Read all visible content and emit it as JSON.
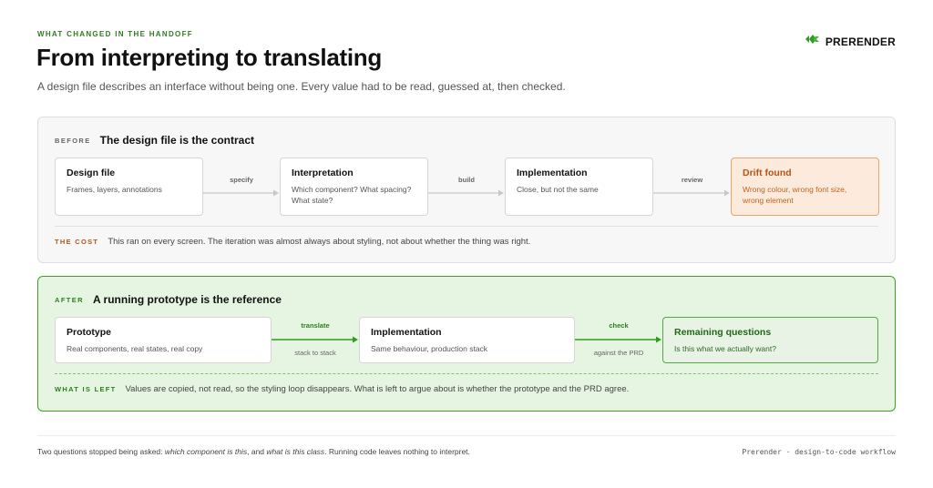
{
  "header": {
    "eyebrow": "WHAT CHANGED IN THE HANDOFF",
    "title": "From interpreting to translating",
    "subtitle": "A design file describes an interface without being one. Every value had to be read, guessed at, then checked."
  },
  "brand": {
    "name": "PRERENDER",
    "icon": "prerender-logo-icon",
    "color": "#2e9c1f"
  },
  "before": {
    "tag": "BEFORE",
    "title": "The design file is the contract",
    "steps": [
      {
        "title": "Design file",
        "desc": "Frames, layers, annotations"
      },
      {
        "title": "Interpretation",
        "desc": "Which component? What spacing? What state?"
      },
      {
        "title": "Implementation",
        "desc": "Close, but not the same"
      },
      {
        "title": "Drift found",
        "desc": "Wrong colour, wrong font size, wrong element"
      }
    ],
    "connectors": [
      "specify",
      "build",
      "review"
    ],
    "note_tag": "THE COST",
    "note": "This ran on every screen. The iteration was almost always about styling, not about whether the thing was right."
  },
  "after": {
    "tag": "AFTER",
    "title": "A running prototype is the reference",
    "steps": [
      {
        "title": "Prototype",
        "desc": "Real components, real states, real copy"
      },
      {
        "title": "Implementation",
        "desc": "Same behaviour, production stack"
      },
      {
        "title": "Remaining questions",
        "desc": "Is this what we actually want?"
      }
    ],
    "connectors": [
      {
        "label": "translate",
        "sub": "stack to stack"
      },
      {
        "label": "check",
        "sub": "against the PRD"
      }
    ],
    "note_tag": "WHAT IS LEFT",
    "note": "Values are copied, not read, so the styling loop disappears. What is left to argue about is whether the prototype and the PRD agree."
  },
  "footer": {
    "left_prefix": "Two questions stopped being asked: ",
    "q1": "which component is this",
    "mid": ", and ",
    "q2": "what is this class",
    "left_suffix": ". Running code leaves nothing to interpret.",
    "right": "Prerender · design-to-code workflow"
  },
  "colors": {
    "accent_green": "#2e7d1f",
    "drift_orange": "#b85412",
    "after_bg": "#e6f5e2",
    "before_bg": "#f7f7f7"
  }
}
